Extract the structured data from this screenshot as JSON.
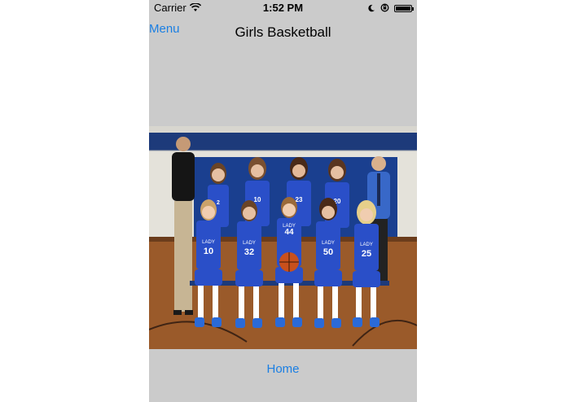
{
  "status_bar": {
    "carrier": "Carrier",
    "time": "1:52 PM"
  },
  "nav": {
    "menu_label": "Menu",
    "title": "Girls Basketball"
  },
  "photo": {
    "back_row_numbers": [
      "2",
      "10",
      "23",
      "20"
    ],
    "front_row_numbers": [
      "10",
      "32",
      "44",
      "50",
      "25"
    ],
    "jersey_text": "LADY"
  },
  "footer": {
    "home_label": "Home"
  },
  "colors": {
    "background": "#cbcbcb",
    "link": "#1b7fe3",
    "jersey": "#2a4fc8"
  }
}
